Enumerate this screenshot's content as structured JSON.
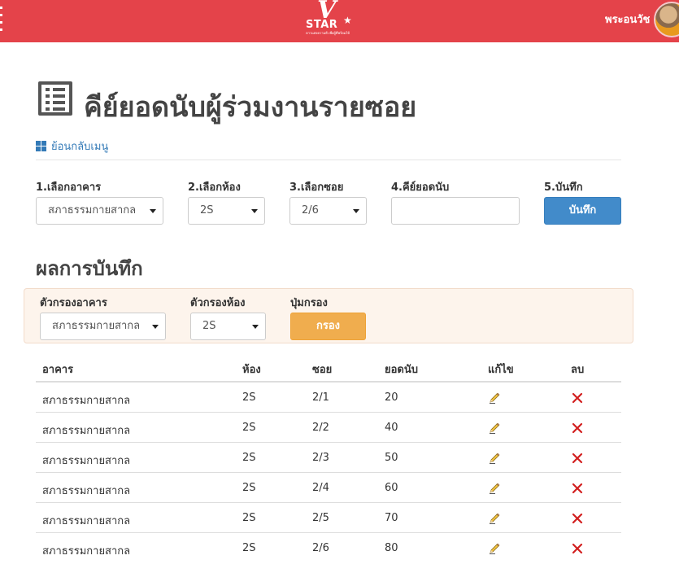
{
  "header": {
    "logo_letter": "V",
    "logo_word": "STAR",
    "logo_tagline": "ดาวแห่งความดี เพื่อผู้ที่พร้อมให้",
    "user_name": "พระอนวัช",
    "bar_color": "#e4434a"
  },
  "page": {
    "title": "คีย์ยอดนับผู้ร่วมงานรายซอย",
    "title_icon": "list-icon",
    "back_link": "ย้อนกลับเมนู",
    "back_icon": "grid-icon"
  },
  "form": {
    "building_label": "1.เลือกอาคาร",
    "building_value": "สภาธรรมกายสากล",
    "room_label": "2.เลือกห้อง",
    "room_value": "2S",
    "soi_label": "3.เลือกซอย",
    "soi_value": "2/6",
    "count_label": "4.คีย์ยอดนับ",
    "count_value": "",
    "save_label": "5.บันทึก",
    "save_button": "บันทึก"
  },
  "results": {
    "title": "ผลการบันทึก",
    "filter": {
      "building_label": "ตัวกรองอาคาร",
      "building_value": "สภาธรรมกายสากล",
      "room_label": "ตัวกรองห้อง",
      "room_value": "2S",
      "button_label": "ปุ่มกรอง",
      "button_text": "กรอง"
    },
    "columns": [
      "อาคาร",
      "ห้อง",
      "ซอย",
      "ยอดนับ",
      "แก้ไข",
      "ลบ"
    ],
    "rows": [
      {
        "building": "สภาธรรมกายสากล",
        "room": "2S",
        "soi": "2/1",
        "count": "20"
      },
      {
        "building": "สภาธรรมกายสากล",
        "room": "2S",
        "soi": "2/2",
        "count": "40"
      },
      {
        "building": "สภาธรรมกายสากล",
        "room": "2S",
        "soi": "2/3",
        "count": "50"
      },
      {
        "building": "สภาธรรมกายสากล",
        "room": "2S",
        "soi": "2/4",
        "count": "60"
      },
      {
        "building": "สภาธรรมกายสากล",
        "room": "2S",
        "soi": "2/5",
        "count": "70"
      },
      {
        "building": "สภาธรรมกายสากล",
        "room": "2S",
        "soi": "2/6",
        "count": "80"
      }
    ],
    "edit_icon": "pencil-icon",
    "delete_icon": "x-icon"
  }
}
